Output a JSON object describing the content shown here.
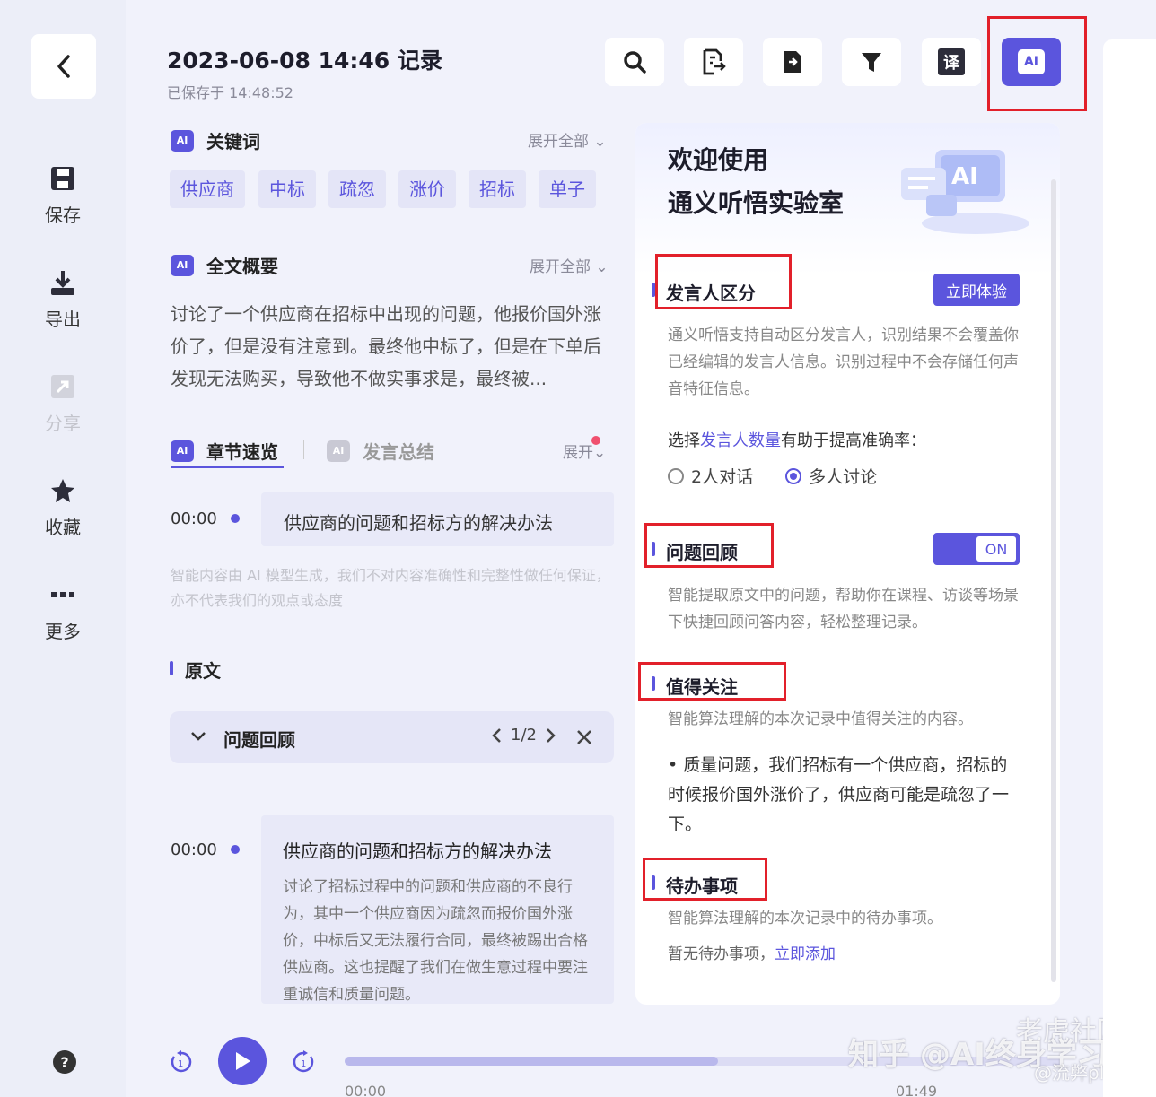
{
  "sidebar": {
    "items": [
      {
        "label": "保存",
        "icon": "save-icon"
      },
      {
        "label": "导出",
        "icon": "download-icon"
      },
      {
        "label": "分享",
        "icon": "share-icon"
      },
      {
        "label": "收藏",
        "icon": "star-icon"
      },
      {
        "label": "更多",
        "icon": "more-icon"
      }
    ],
    "help": "?"
  },
  "header": {
    "title": "2023-06-08 14:46 记录",
    "saved": "已保存于 14:48:52",
    "toolbar_translate": "译",
    "toolbar_ai": "AI"
  },
  "keywords": {
    "title": "关键词",
    "expand": "展开全部",
    "items": [
      "供应商",
      "中标",
      "疏忽",
      "涨价",
      "招标",
      "单子"
    ]
  },
  "summary": {
    "title": "全文概要",
    "expand": "展开全部",
    "text": "讨论了一个供应商在招标中出现的问题，他报价国外涨价了，但是没有注意到。最终他中标了，但是在下单后发现无法购买，导致他不做实事求是，最终被..."
  },
  "chapters": {
    "tab_active": "章节速览",
    "tab_other": "发言总结",
    "expand": "展开",
    "items": [
      {
        "time": "00:00",
        "title": "供应商的问题和招标方的解决办法"
      }
    ],
    "disclaimer": "智能内容由 AI 模型生成，我们不对内容准确性和完整性做任何保证，亦不代表我们的观点或态度"
  },
  "original": {
    "title": "原文",
    "qa_label": "问题回顾",
    "qa_pager": "1/2",
    "entry": {
      "time": "00:00",
      "title": "供应商的问题和招标方的解决办法",
      "body": "讨论了招标过程中的问题和供应商的不良行为，其中一个供应商因为疏忽而报价国外涨价，中标后又无法履行合同，最终被踢出合格供应商。这也提醒了我们在做生意过程中要注重诚信和质量问题。"
    }
  },
  "player": {
    "start": "00:00",
    "end": "01:49",
    "progress": 0.52
  },
  "watermark": {
    "main": "知乎 @AI终身学习",
    "top": "老虎社区",
    "small": "@流弊plus"
  },
  "panel": {
    "welcome_line1": "欢迎使用",
    "welcome_line2": "通义听悟实验室",
    "hero_art_text": "AI",
    "speaker": {
      "title": "发言人区分",
      "button": "立即体验",
      "desc": "通义听悟支持自动区分发言人，识别结果不会覆盖你已经编辑的发言人信息。识别过程中不会存储任何声音特征信息。",
      "choose_prefix": "选择",
      "choose_highlight": "发言人数量",
      "choose_suffix": "有助于提高准确率：",
      "option_two": "2人对话",
      "option_multi": "多人讨论",
      "selected": "多人讨论"
    },
    "qa_review": {
      "title": "问题回顾",
      "toggle": "ON",
      "desc": "智能提取原文中的问题，帮助你在课程、访谈等场景下快捷回顾问答内容，轻松整理记录。"
    },
    "focus": {
      "title": "值得关注",
      "desc": "智能算法理解的本次记录中值得关注的内容。",
      "item": "• 质量问题，我们招标有一个供应商，招标的时候报价国外涨价了，供应商可能是疏忽了一下。"
    },
    "todo": {
      "title": "待办事项",
      "desc": "智能算法理解的本次记录中的待办事项。",
      "empty": "暂无待办事项，",
      "add_link": "立即添加"
    }
  },
  "colors": {
    "accent": "#5b55dd",
    "highlight_box": "#e2202a"
  }
}
